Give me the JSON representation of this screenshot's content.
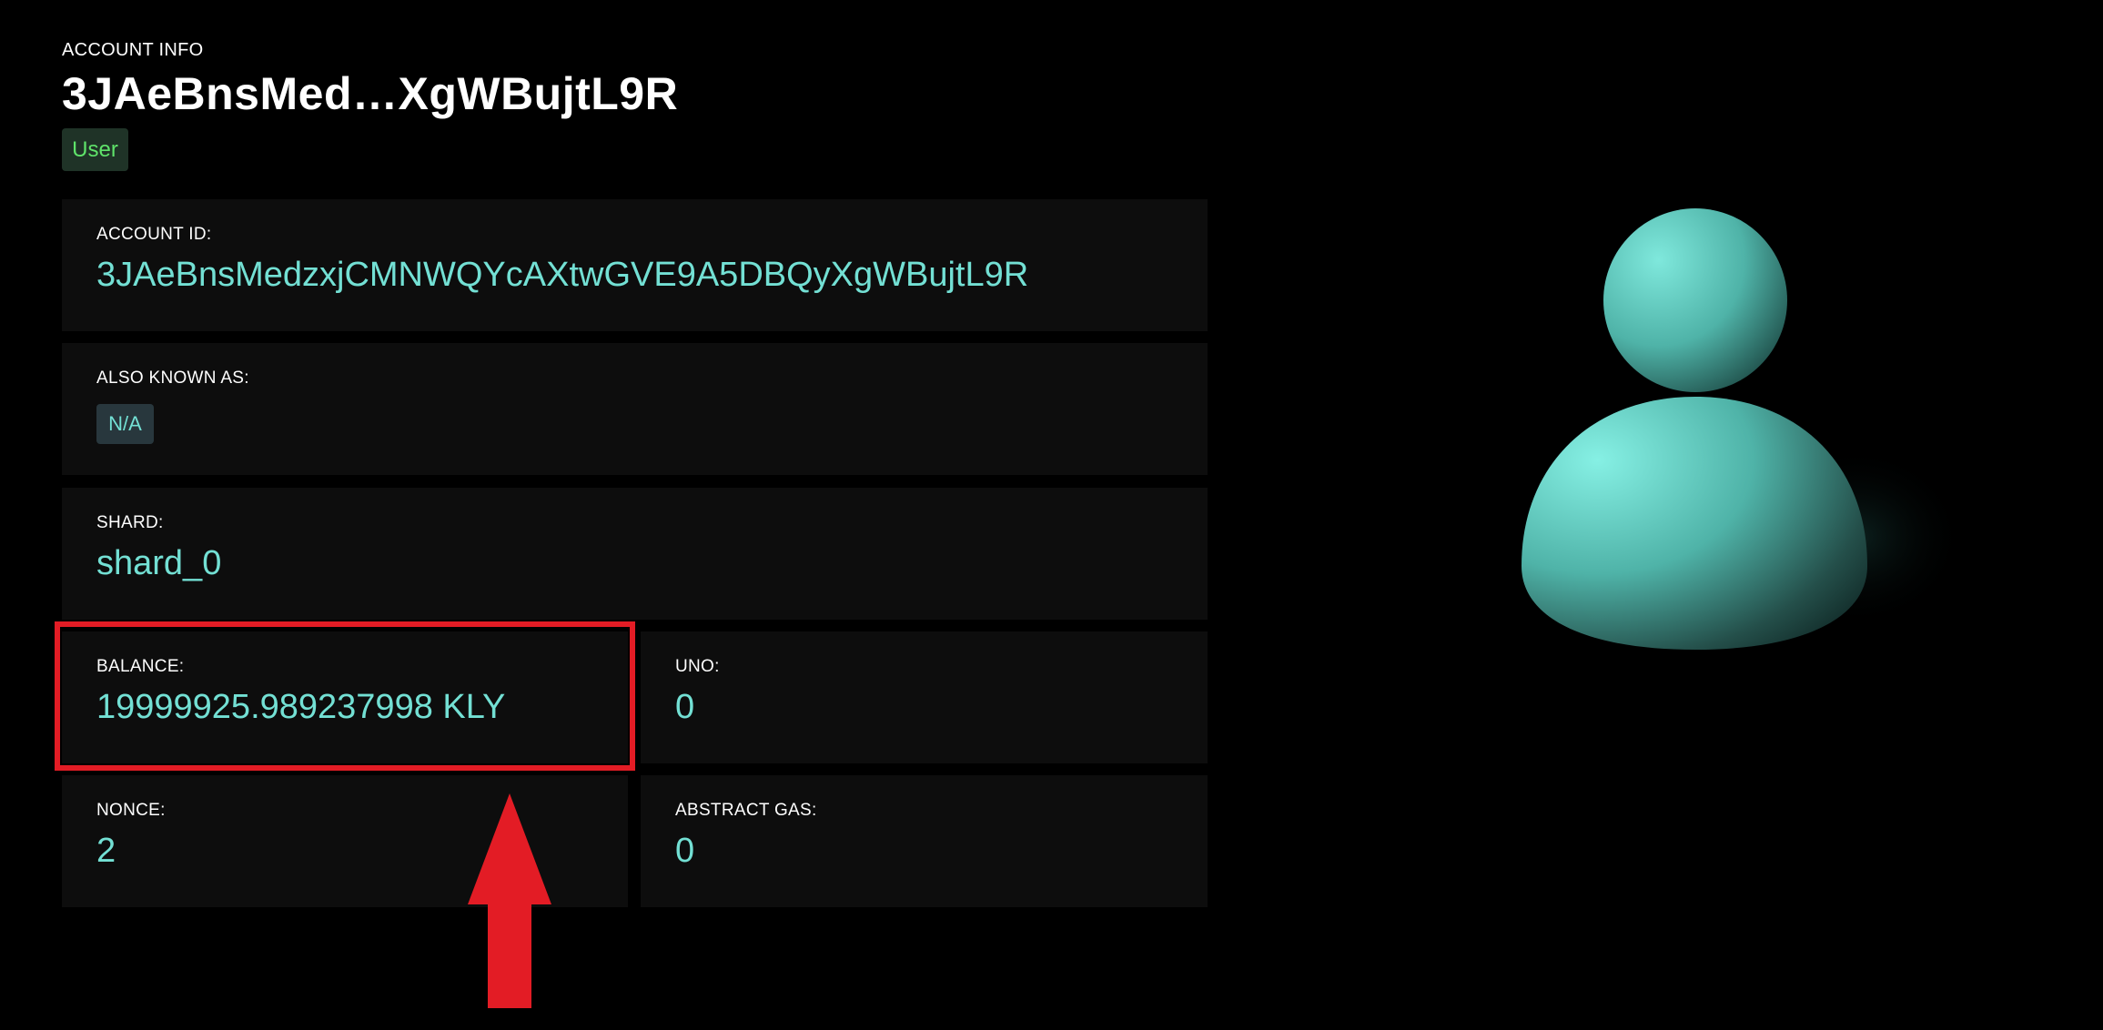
{
  "header": {
    "label": "ACCOUNT INFO",
    "title": "3JAeBnsMed…XgWBujtL9R",
    "badge": "User"
  },
  "cards": {
    "account_id": {
      "label": "ACCOUNT ID:",
      "value": "3JAeBnsMedzxjCMNWQYcAXtwGVE9A5DBQyXgWBujtL9R"
    },
    "aka": {
      "label": "ALSO KNOWN AS:",
      "value": "N/A"
    },
    "shard": {
      "label": "SHARD:",
      "value": "shard_0"
    },
    "balance": {
      "label": "BALANCE:",
      "value": "19999925.989237998 KLY"
    },
    "uno": {
      "label": "UNO:",
      "value": "0"
    },
    "nonce": {
      "label": "NONCE:",
      "value": "2"
    },
    "abstract_gas": {
      "label": "ABSTRACT GAS:",
      "value": "0"
    }
  },
  "annotations": {
    "highlight_color": "#e31c25",
    "arrow_icon": "arrow-up-icon"
  },
  "colors": {
    "accent": "#73e0d4",
    "badge_text": "#5fe36a",
    "card_bg": "#0d0d0d"
  },
  "avatar": {
    "icon": "user-avatar-icon"
  }
}
